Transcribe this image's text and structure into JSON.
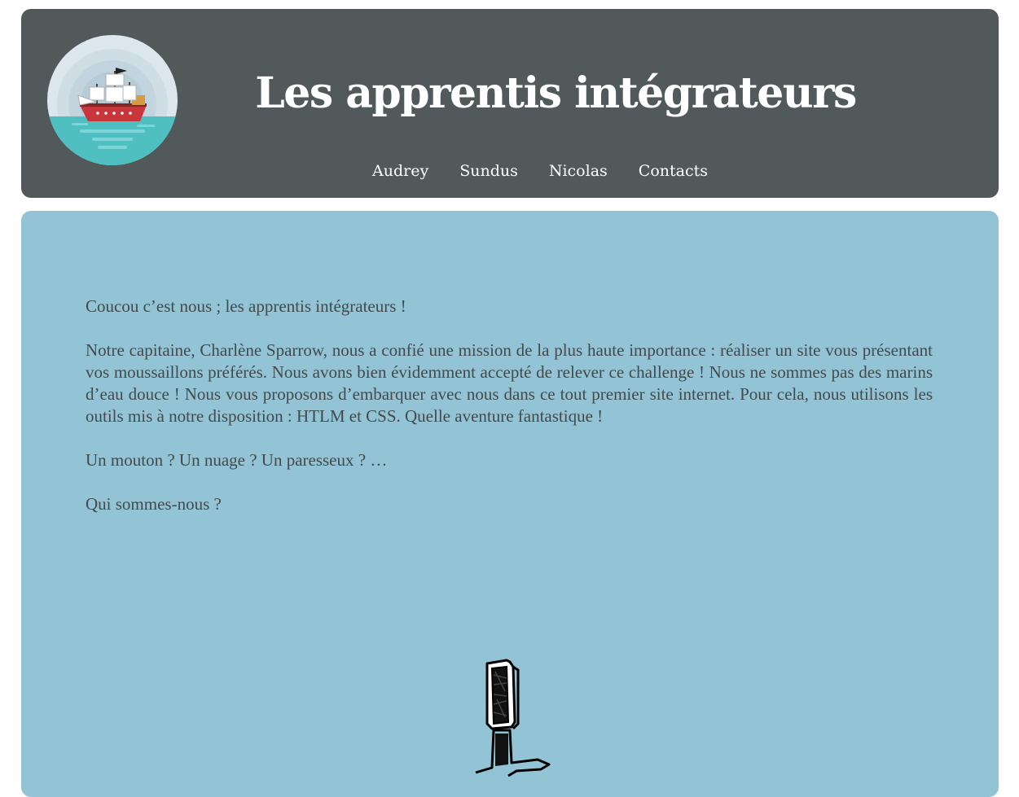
{
  "header": {
    "title": "Les apprentis intégrateurs",
    "logo_icon": "pirate-ship-icon",
    "nav": [
      {
        "label": "Audrey"
      },
      {
        "label": "Sundus"
      },
      {
        "label": "Nicolas"
      },
      {
        "label": "Contacts"
      }
    ]
  },
  "main": {
    "paragraphs": [
      "Coucou c’est nous ; les apprentis intégrateurs !",
      "Notre capitaine, Charlène Sparrow, nous a confié une mission de la plus haute importance : réaliser un site vous présentant vos moussaillons préférés. Nous avons bien évidemment accepté de relever ce challenge ! Nous ne sommes pas des marins d’eau douce ! Nous vous proposons d’embarquer avec nous dans ce tout premier site internet. Pour cela, nous utilisons les outils mis à notre disposition : HTLM et CSS. Quelle aventure fantastique !",
      "Un mouton ? Un nuage ? Un paresseux ? …",
      "Qui sommes-nous ?"
    ],
    "illustration_icon": "doodle-sketch-icon"
  },
  "colors": {
    "header_bg": "#52595b",
    "main_bg": "#93c4d5",
    "text": "#44494b",
    "sea": "#4fbfc1"
  }
}
